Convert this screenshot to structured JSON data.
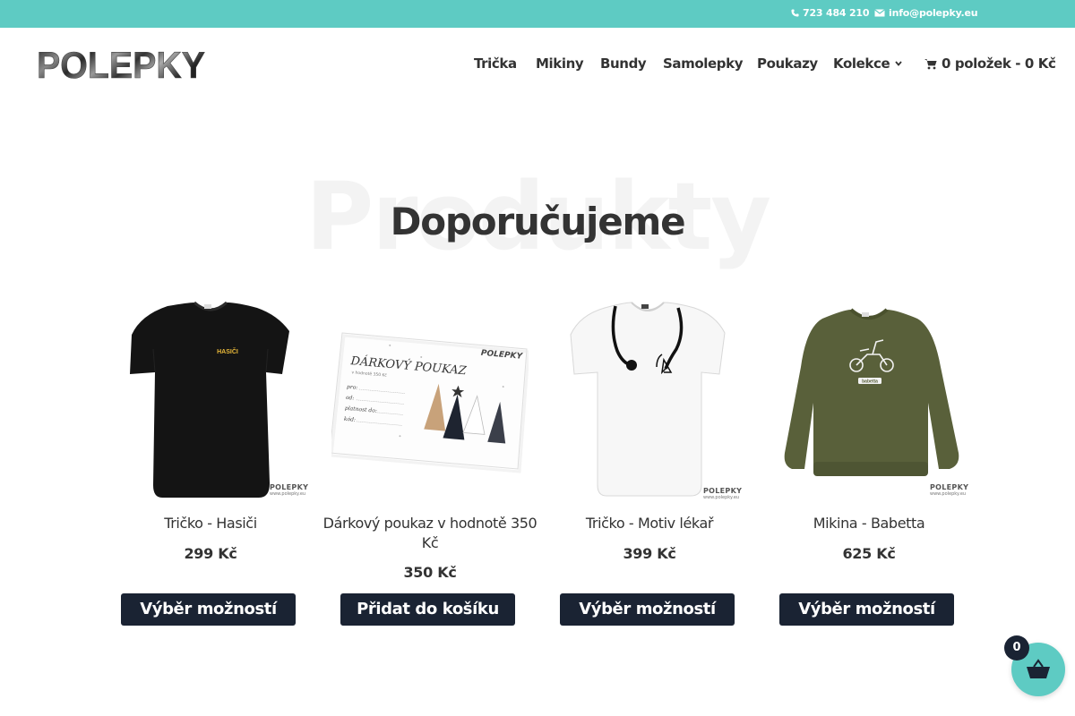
{
  "topbar": {
    "phone": "723 484 210",
    "email": "info@polepky.eu",
    "background_color": "#5ecbc3",
    "phone_icon": "phone-icon",
    "email_icon": "envelope-icon"
  },
  "logo": {
    "text": "POLEPKY"
  },
  "nav": {
    "items": [
      {
        "label": "Trička"
      },
      {
        "label": "Mikiny"
      },
      {
        "label": "Bundy"
      },
      {
        "label": "Samolepky"
      },
      {
        "label": "Poukazy"
      },
      {
        "label": "Kolekce",
        "has_submenu": true
      }
    ],
    "cart": {
      "label": "0 položek - 0 Kč",
      "icon": "shopping-cart-icon"
    }
  },
  "section": {
    "background_title": "Produkty",
    "title": "Doporučujeme"
  },
  "products": [
    {
      "title": "Tričko - Hasiči",
      "price": "299 Kč",
      "button": "Výběr možností",
      "print_text": "HASIČI"
    },
    {
      "title": "Dárkový poukaz v hodnotě 350 Kč",
      "price": "350 Kč",
      "button": "Přidat do košíku"
    },
    {
      "title": "Tričko - Motiv lékař",
      "price": "399 Kč",
      "button": "Výběr možností"
    },
    {
      "title": "Mikina - Babetta",
      "price": "625 Kč",
      "button": "Výběr možností",
      "print_text": "babetta"
    }
  ],
  "voucher": {
    "heading": "DÁRKOVÝ POUKAZ",
    "subheading": "v hodnotě 350 Kč",
    "brand": "POLEPKY",
    "fields": [
      "pro:",
      "od:",
      "platnost do:",
      "kód:"
    ]
  },
  "watermark": {
    "brand": "POLEPKY",
    "url": "www.polepky.eu"
  },
  "floating_cart": {
    "count": "0",
    "icon": "basket-icon",
    "color": "#5ecbc3"
  },
  "colors": {
    "button": "#1a2333",
    "text": "#333333",
    "accent": "#5ecbc3"
  }
}
